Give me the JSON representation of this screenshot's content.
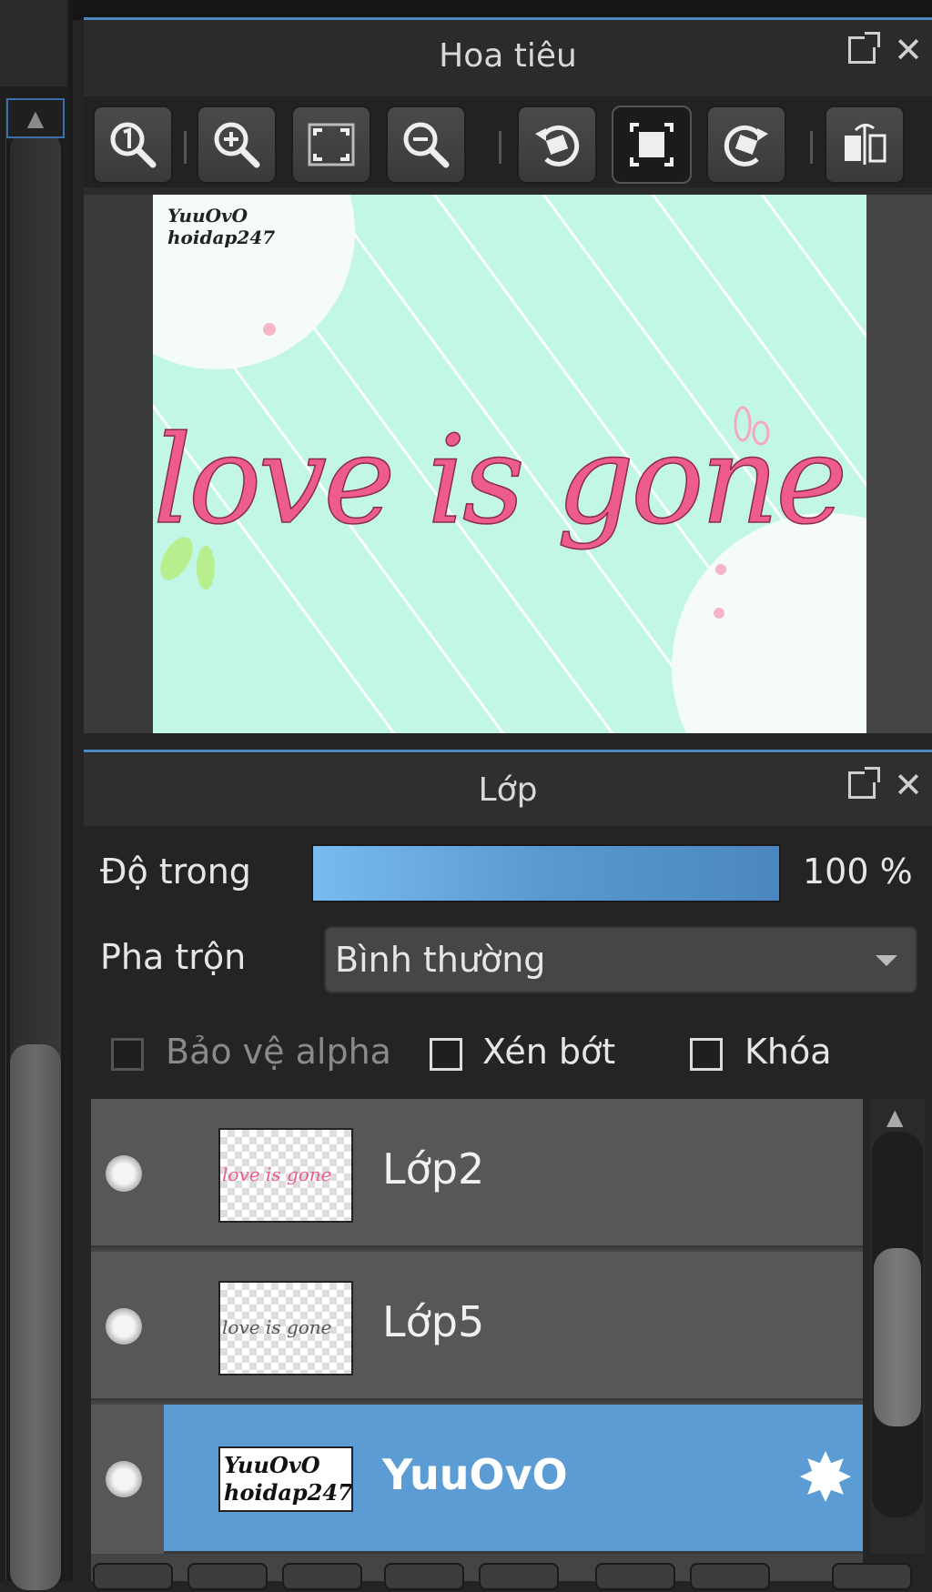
{
  "navigator": {
    "title": "Hoa tiêu",
    "tools": [
      {
        "icon": "zoom-actual-icon"
      },
      {
        "icon": "zoom-in-icon"
      },
      {
        "icon": "fit-screen-icon"
      },
      {
        "icon": "zoom-out-icon"
      },
      {
        "icon": "rotate-left-icon"
      },
      {
        "icon": "reset-view-icon"
      },
      {
        "icon": "rotate-right-icon"
      },
      {
        "icon": "flip-horizontal-icon"
      }
    ],
    "canvas": {
      "watermark_line1": "YuuOvO",
      "watermark_line2": "hoidap247",
      "text": "love is gone",
      "bg_color": "#c2f6e7",
      "text_color": "#ee5c8f"
    }
  },
  "layers": {
    "title": "Lớp",
    "opacity_label": "Độ trong",
    "opacity_value": "100 %",
    "opacity_fraction": 1.0,
    "blend_label": "Pha trộn",
    "blend_value": "Bình thường",
    "checkboxes": {
      "protect_alpha": "Bảo vệ alpha",
      "clip": "Xén bớt",
      "lock": "Khóa"
    },
    "items": [
      {
        "name": "Lớp2"
      },
      {
        "name": "Lớp5"
      },
      {
        "name": "YuuOvO",
        "thumb_line1": "YuuOvO",
        "thumb_line2": "hoidap247"
      }
    ]
  },
  "colors": {
    "accent": "#4d87bf",
    "selected_row": "#5b9cd4"
  }
}
